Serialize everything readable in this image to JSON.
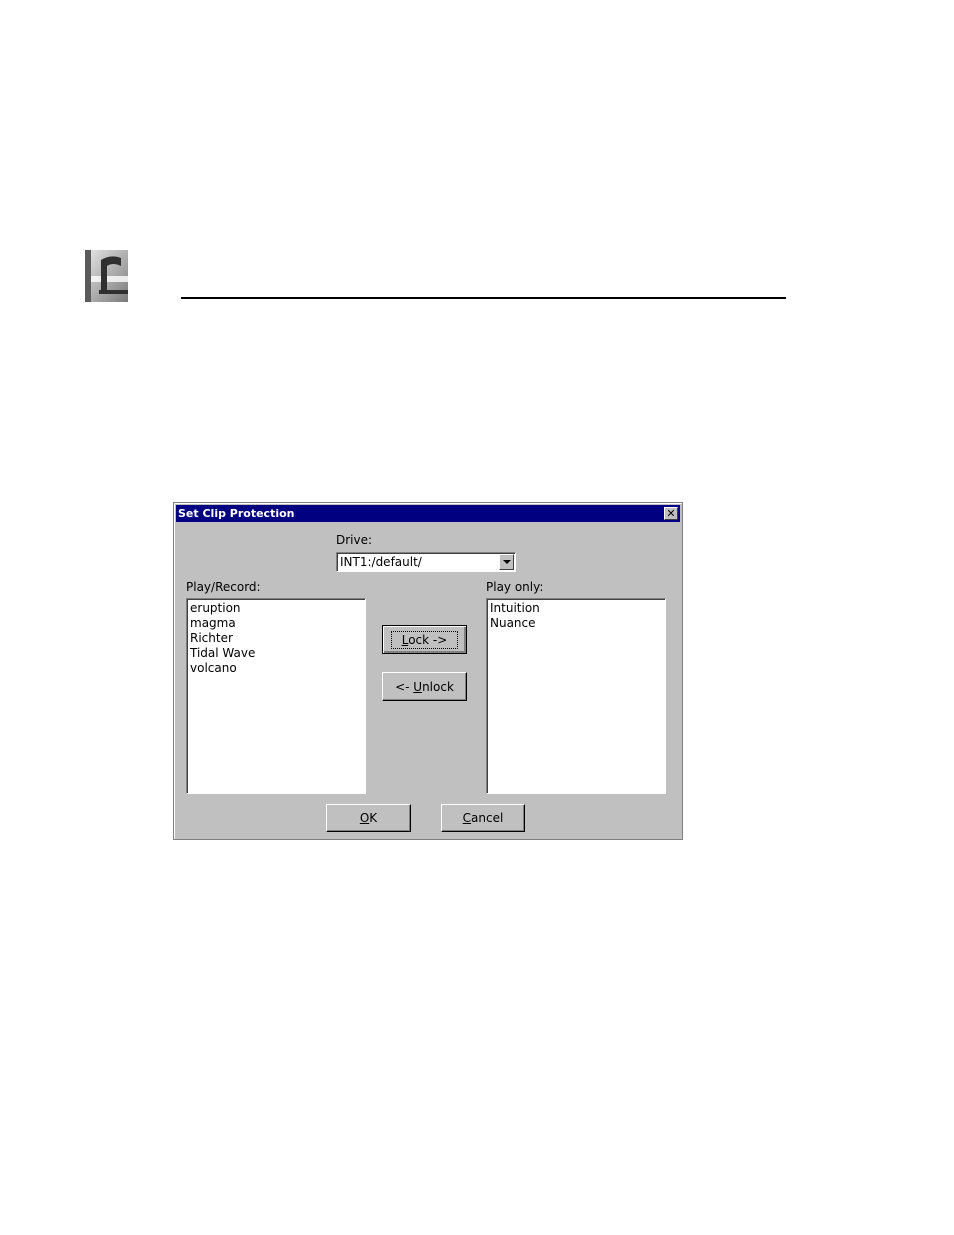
{
  "dialog": {
    "title": "Set Clip Protection",
    "drive": {
      "label": "Drive:",
      "value": "INT1:/default/"
    },
    "play_record": {
      "label": "Play/Record:",
      "items": [
        "eruption",
        "magma",
        "Richter",
        "Tidal Wave",
        "volcano"
      ]
    },
    "play_only": {
      "label": "Play only:",
      "items": [
        "Intuition",
        "Nuance"
      ]
    },
    "buttons": {
      "lock": {
        "accel": "L",
        "rest": "ock ->"
      },
      "unlock": {
        "pre": "<- ",
        "accel": "U",
        "rest": "nlock"
      },
      "ok": {
        "accel": "O",
        "rest": "K"
      },
      "cancel": {
        "accel": "C",
        "rest": "ancel"
      }
    }
  },
  "colors": {
    "titlebar": "#000080",
    "face": "#c0c0c0"
  },
  "icons": {
    "close": "close-icon",
    "dropdown": "chevron-down-icon"
  }
}
